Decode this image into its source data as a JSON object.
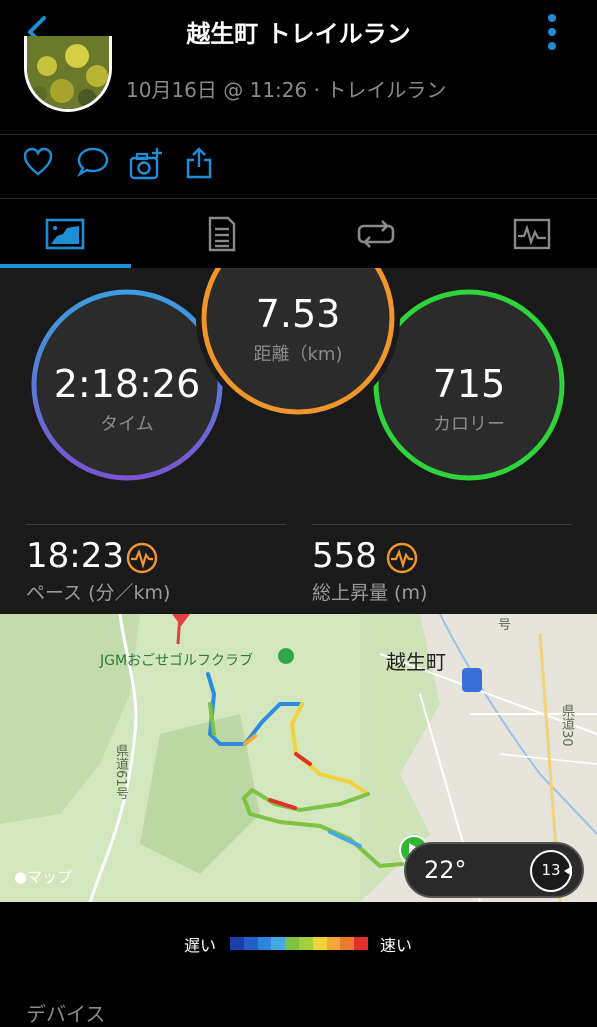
{
  "header": {
    "title": "越生町 トレイルラン",
    "back_icon": "chevron-left-icon",
    "more_icon": "more-vertical-icon",
    "accent": "#1e8fd6"
  },
  "activity": {
    "meta": "10月16日 @ 11:26 · トレイルラン"
  },
  "social": [
    "heart-icon",
    "comment-icon",
    "camera-add-icon",
    "share-icon"
  ],
  "tabs": [
    {
      "icon": "overview-icon",
      "selected": true
    },
    {
      "icon": "details-icon",
      "selected": false
    },
    {
      "icon": "laps-icon",
      "selected": false
    },
    {
      "icon": "charts-icon",
      "selected": false
    }
  ],
  "stats": {
    "distance": {
      "value": "7.53",
      "label": "距離（km)",
      "color": "#f0962b"
    },
    "time": {
      "value": "2:18:26",
      "label": "タイム"
    },
    "calories": {
      "value": "715",
      "label": "カロリー",
      "color": "#2fd33a"
    }
  },
  "metrics": {
    "pace": {
      "value": "18:23",
      "label": "ペース (分／km)"
    },
    "elevation": {
      "value": "558",
      "label": "総上昇量 (m)"
    }
  },
  "map": {
    "town": "越生町",
    "golf": "JGMおごせゴルフクラブ",
    "route_left": "県道61号",
    "route_right": "県道30",
    "road_top": "号",
    "apple_maps": "マップ"
  },
  "weather": {
    "temp": "22°",
    "wind": "13"
  },
  "legend": {
    "slow": "遅い",
    "fast": "速い",
    "colors": [
      "#1b3fa8",
      "#2260c8",
      "#2f86e0",
      "#44a9e6",
      "#7dc242",
      "#a7cf3a",
      "#f0d23a",
      "#f2a83a",
      "#ee7a2d",
      "#e0302b"
    ]
  },
  "section": {
    "devices": "デバイス"
  }
}
